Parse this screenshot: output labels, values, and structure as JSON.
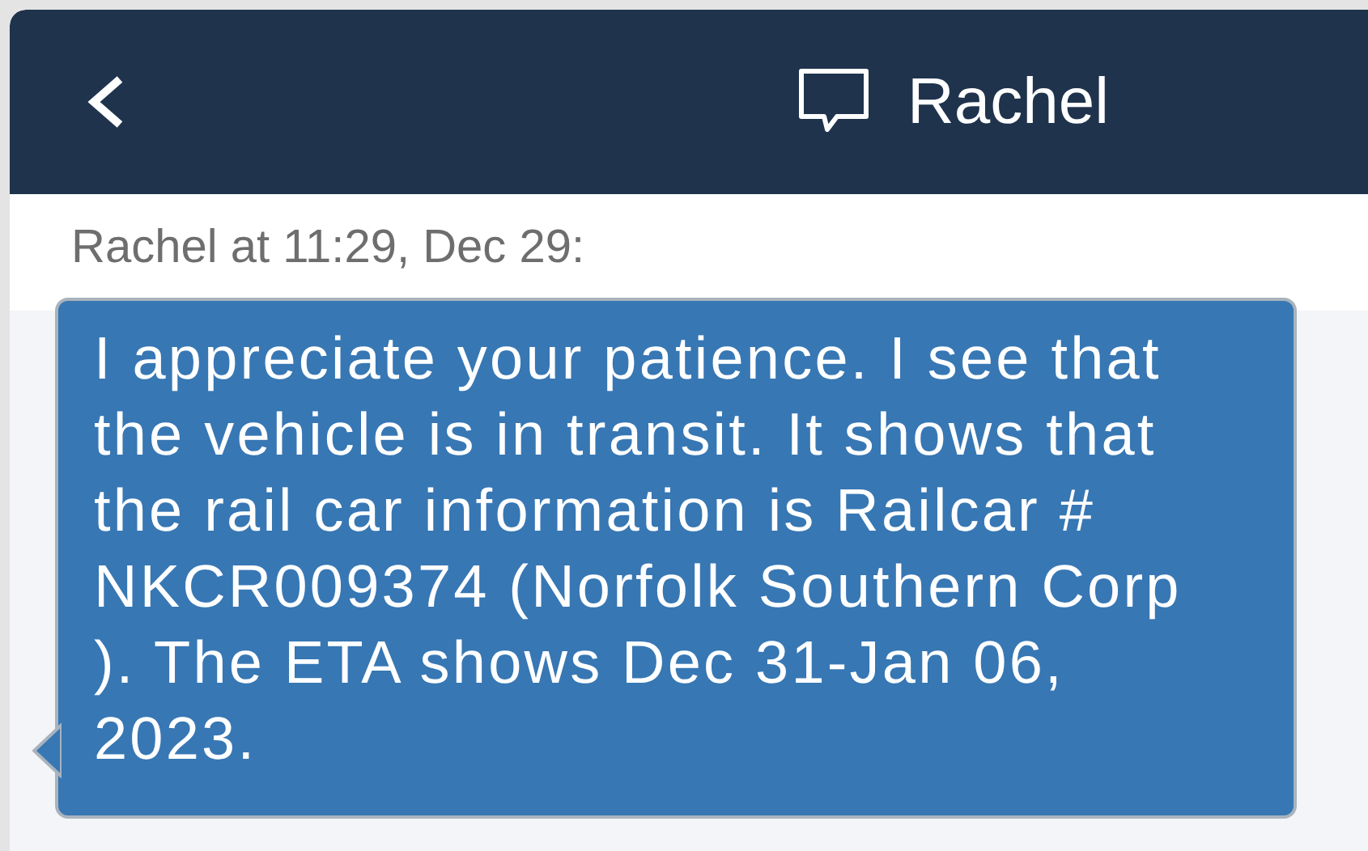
{
  "header": {
    "title": "Rachel"
  },
  "message": {
    "meta": "Rachel at 11:29, Dec 29:",
    "text": "I appreciate your patience. I see that the vehicle is in transit. It shows that the rail car information is Railcar # NKCR009374 (Norfolk Southern Corp ). The ETA shows Dec 31-Jan 06, 2023."
  }
}
